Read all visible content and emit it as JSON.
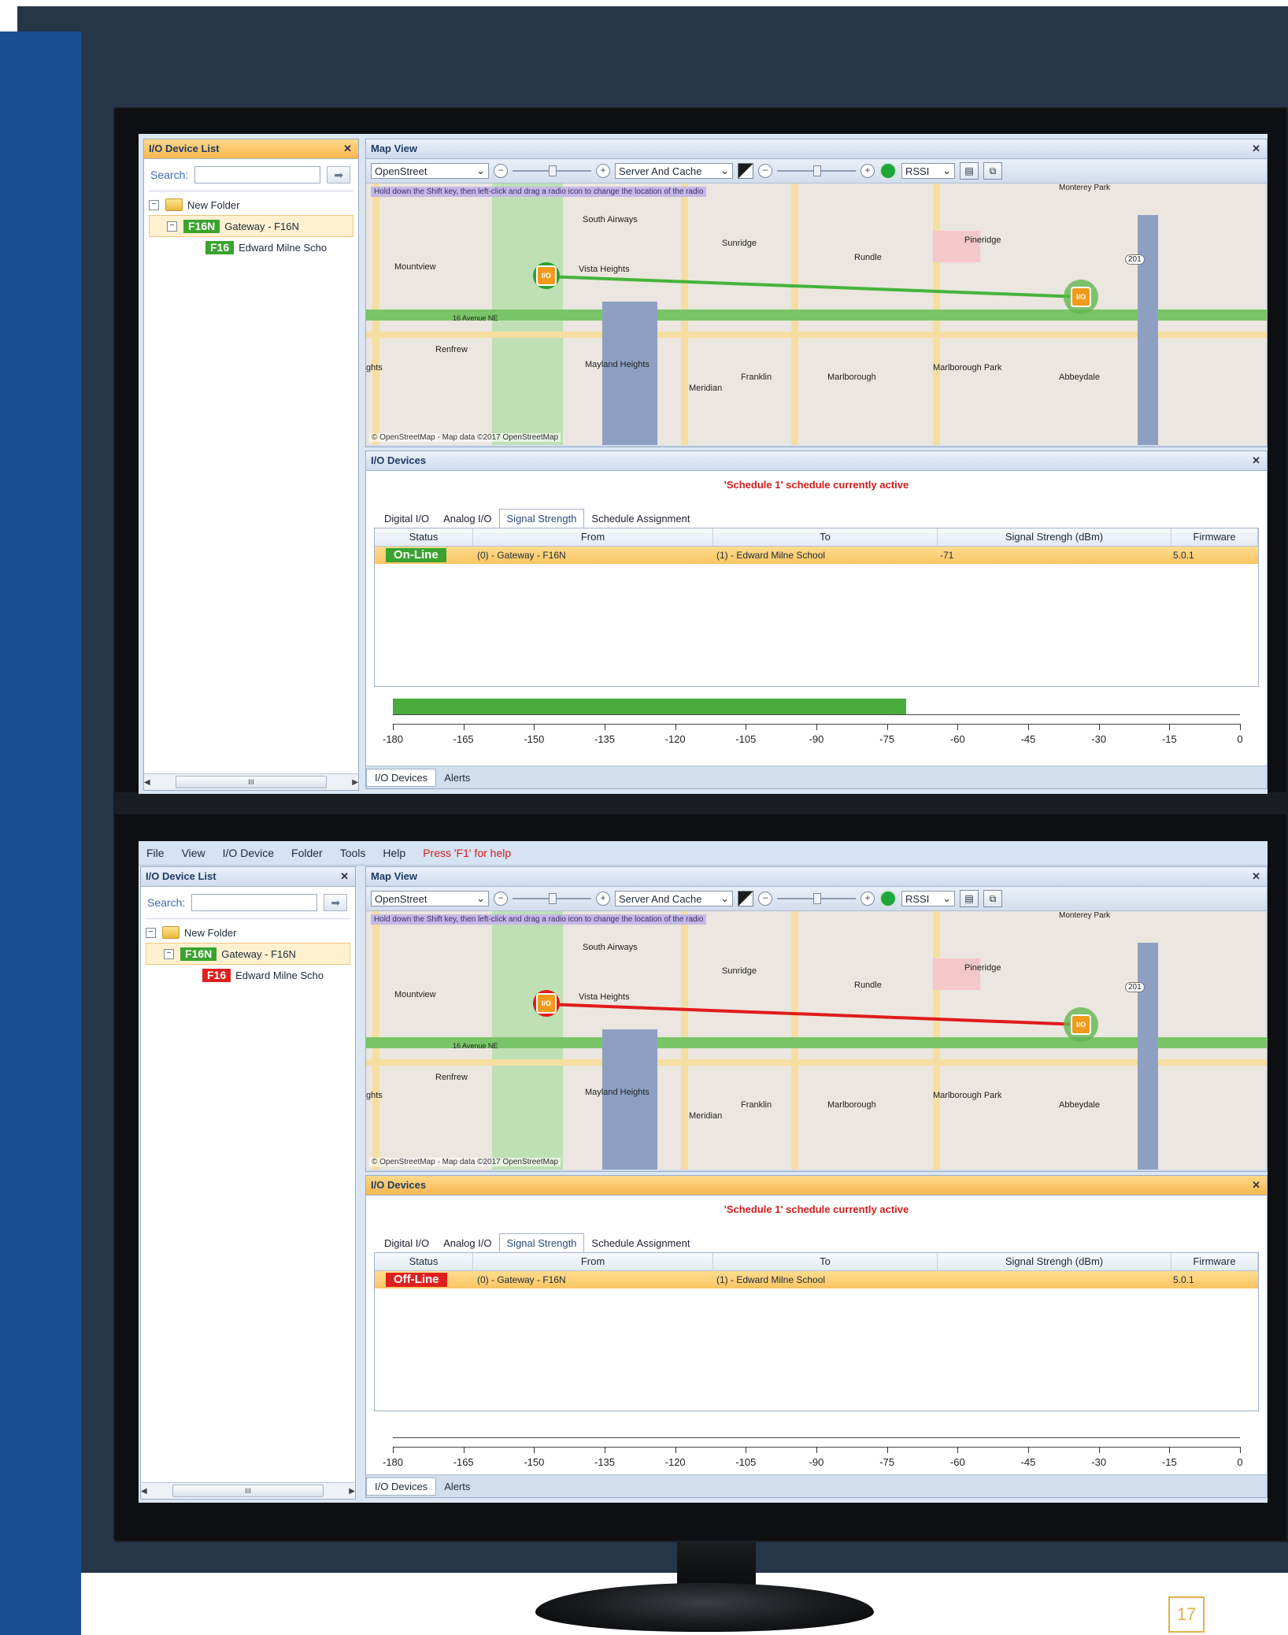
{
  "page_number": "17",
  "menu": [
    "File",
    "View",
    "I/O Device",
    "Folder",
    "Tools",
    "Help"
  ],
  "menu_hint": "Press 'F1' for help",
  "left_pane": {
    "title": "I/O Device List",
    "search_label": "Search:",
    "go_icon": "arrow-right-icon",
    "scroll_thumb": "III",
    "tree": {
      "folder": "New Folder",
      "gateway_badge": "F16N",
      "gateway_label": "Gateway - F16N",
      "child_badge": "F16",
      "child_label": "Edward Milne Scho"
    }
  },
  "map": {
    "title": "Map View",
    "provider": "OpenStreet",
    "cache": "Server And Cache",
    "metric": "RSSI",
    "hint": "Hold down the Shift key, then left-click and drag a radio icon to change the location of the radio",
    "copyright": "© OpenStreetMap - Map data ©2017 OpenStreetMap",
    "places": {
      "south_airways": "South Airways",
      "sunridge": "Sunridge",
      "rundle": "Rundle",
      "pineridge": "Pineridge",
      "mountview": "Mountview",
      "vista_heights": "Vista Heights",
      "renfrew": "Renfrew",
      "mayland": "Mayland Heights",
      "franklin": "Franklin",
      "marlborough": "Marlborough",
      "marlborough_park": "Marlborough Park",
      "abbeydale": "Abbeydale",
      "meridian": "Meridian",
      "avenue": "16 Avenue NE",
      "monterey": "Monterey Park",
      "hts": "ghts",
      "route_201": "201"
    },
    "marker_label": "I/O"
  },
  "devices": {
    "title": "I/O Devices",
    "schedule": "'Schedule 1' schedule currently active",
    "tabs": [
      "Digital I/O",
      "Analog I/O",
      "Signal Strength",
      "Schedule Assignment"
    ],
    "columns": [
      "Status",
      "From",
      "To",
      "Signal Strengh (dBm)",
      "Firmware"
    ],
    "axis_ticks": [
      "-180",
      "-165",
      "-150",
      "-135",
      "-120",
      "-105",
      "-90",
      "-75",
      "-60",
      "-45",
      "-30",
      "-15",
      "0"
    ],
    "bottom_tabs": [
      "I/O Devices",
      "Alerts"
    ]
  },
  "screens": [
    {
      "status": "On-Line",
      "status_color": "#3aa32f",
      "from": "(0) - Gateway - F16N",
      "to": "(1) - Edward Milne School",
      "signal": "-71",
      "signal_value": -71,
      "firmware": "5.0.1",
      "link_color": "#45b43a",
      "child_badge_color": "#3aa32f"
    },
    {
      "status": "Off-Line",
      "status_color": "#e02020",
      "from": "(0) - Gateway - F16N",
      "to": "(1) - Edward Milne School",
      "signal": "",
      "signal_value": null,
      "firmware": "5.0.1",
      "link_color": "#e01b1b",
      "child_badge_color": "#e02020"
    }
  ]
}
